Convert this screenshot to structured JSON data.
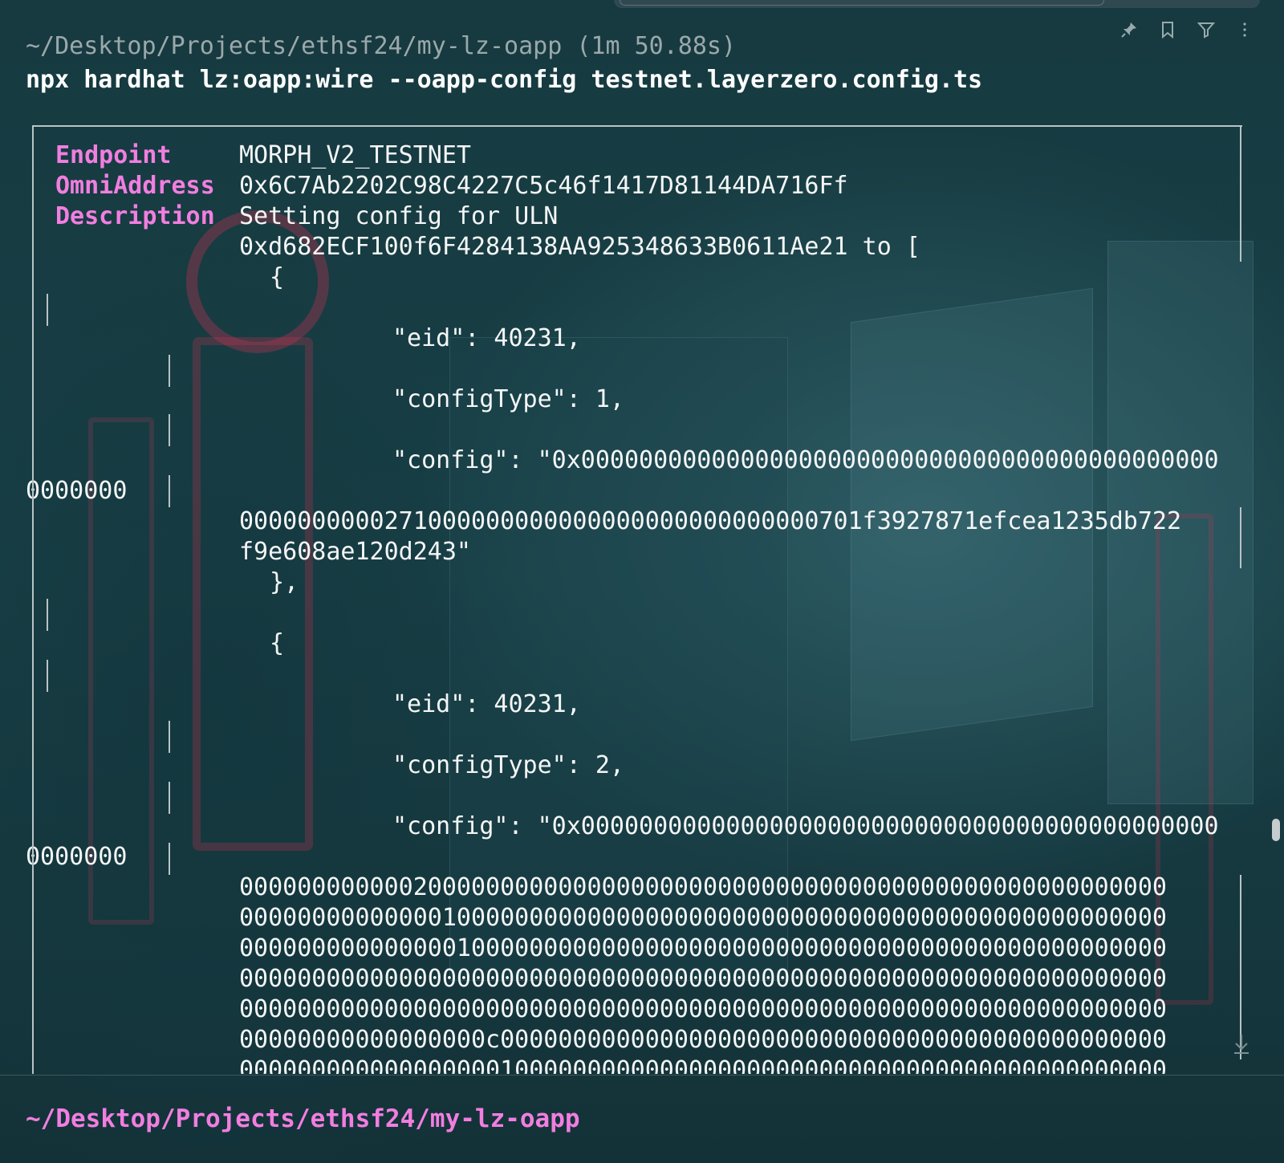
{
  "header": {
    "cwd_with_time": "~/Desktop/Projects/ethsf24/my-lz-oapp (1m 50.88s)",
    "command": "npx hardhat lz:oapp:wire --oapp-config testnet.layerzero.config.ts"
  },
  "toolbar": {
    "icons": [
      "pin-icon",
      "bookmark-icon",
      "filter-icon",
      "more-icon"
    ]
  },
  "output": {
    "endpoint_label": "Endpoint",
    "endpoint_value": "MORPH_V2_TESTNET",
    "omni_label": "OmniAddress",
    "omni_value": "0x6C7Ab2202C98C4227C5c46f1417D81144DA716Ff",
    "desc_label": "Description",
    "desc_line1": "Setting config for ULN",
    "desc_line2": "0xd682ECF100f6F4284138AA925348633B0611Ae21 to [",
    "open_brace_1": "{",
    "eid_1": "\"eid\": 40231,",
    "configtype_1": "\"configType\": 1,",
    "config_1_a": "\"config\": \"0x00000000000000000000000000000000000000000000",
    "config_1_b": "0000000",
    "config_1_c": "0000000000271000000000000000000000000000701f3927871efcea1235db722",
    "config_1_d": "f9e608ae120d243\"",
    "close_brace_1": "},",
    "open_brace_2": "{",
    "eid_2": "\"eid\": 40231,",
    "configtype_2": "\"configType\": 2,",
    "config_2_a": "\"config\": \"0x00000000000000000000000000000000000000000000",
    "config_2_b": "0000000",
    "config_2_rows": [
      "0000000000002000000000000000000000000000000000000000000000000000",
      "0000000000000010000000000000000000000000000000000000000000000000",
      "0000000000000001000000000000000000000000000000000000000000000000",
      "0000000000000000000000000000000000000000000000000000000000000000",
      "0000000000000000000000000000000000000000000000000000000000000000",
      "00000000000000000c0000000000000000000000000000000000000000000000",
      "0000000000000000001000000000000000000000000000000000000000000000"
    ]
  },
  "footer": {
    "prompt": "~/Desktop/Projects/ethsf24/my-lz-oapp"
  },
  "colors": {
    "accent_pink": "#f27ee0",
    "background": "#16393f",
    "text": "#f4f6f6"
  }
}
